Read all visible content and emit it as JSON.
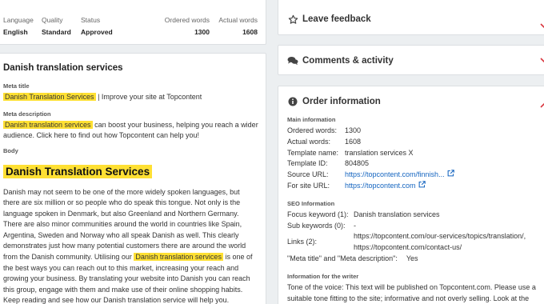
{
  "stats": {
    "language": {
      "label": "Language",
      "value": "English"
    },
    "quality": {
      "label": "Quality",
      "value": "Standard"
    },
    "status": {
      "label": "Status",
      "value": "Approved"
    },
    "ordered": {
      "label": "Ordered words",
      "value": "1300"
    },
    "actual": {
      "label": "Actual words",
      "value": "1608"
    }
  },
  "doc": {
    "title": "Danish translation services",
    "meta_title_label": "Meta title",
    "meta_title_hl": "Danish Translation Services",
    "meta_title_rest": " | Improve your site at Topcontent",
    "meta_desc_label": "Meta description",
    "meta_desc_hl": "Danish translation services",
    "meta_desc_rest": " can boost your business, helping you reach a wider audience. Click here to find out how Topcontent can help you!",
    "body_label": "Body",
    "heading": "Danish Translation Services",
    "body_part1": "Danish may not seem to be one of the more widely spoken languages, but there are six million or so people who do speak this tongue. Not only is the language spoken in Denmark, but also Greenland and Northern Germany. There are also minor communities around the world in countries like Spain, Argentina, Sweden and Norway who all speak Danish as well. This clearly demonstrates just how many potential customers there are around the world from the Danish community. Utilising our ",
    "body_hl": "Danish translation services",
    "body_part2": " is one of the best ways you can reach out to this market, increasing your reach and growing your business. By translating your website into Danish you can reach this group, engage with them and make use of their online shopping habits. Keep reading and see how our Danish translation service will help you."
  },
  "panels": {
    "feedback": "Leave feedback",
    "comments": "Comments & activity",
    "order": "Order information"
  },
  "order_info": {
    "main_label": "Main information",
    "ordered_k": "Ordered words:",
    "ordered_v": "1300",
    "actual_k": "Actual words:",
    "actual_v": "1608",
    "template_k": "Template name:",
    "template_v": "translation services X",
    "template_id_k": "Template ID:",
    "template_id_v": "804805",
    "source_k": "Source URL:",
    "source_v": "https://topcontent.com/finnish...",
    "site_k": "For site URL:",
    "site_v": "https://topcontent.com",
    "seo_label": "SEO Information",
    "focus_k": "Focus keyword (1):",
    "focus_v": "Danish translation services",
    "sub_k": "Sub keywords (0):",
    "sub_v": "-",
    "links_k": "Links (2):",
    "link1": "https://topcontent.com/our-services/topics/translation/,",
    "link2": "https://topcontent.com/contact-us/",
    "meta_k": "\"Meta title\" and \"Meta description\":",
    "meta_v": "Yes",
    "writer_label": "Information for the writer",
    "writer_text": "Tone of the voice: This text will be published on Topcontent.com. Please use a suitable tone fitting to the site; informative and not overly selling. Look at the example text from the link \"Source URL\"."
  },
  "colors": {
    "highlight": "#ffe033",
    "link": "#1565c0",
    "chevron": "#d9363e"
  }
}
